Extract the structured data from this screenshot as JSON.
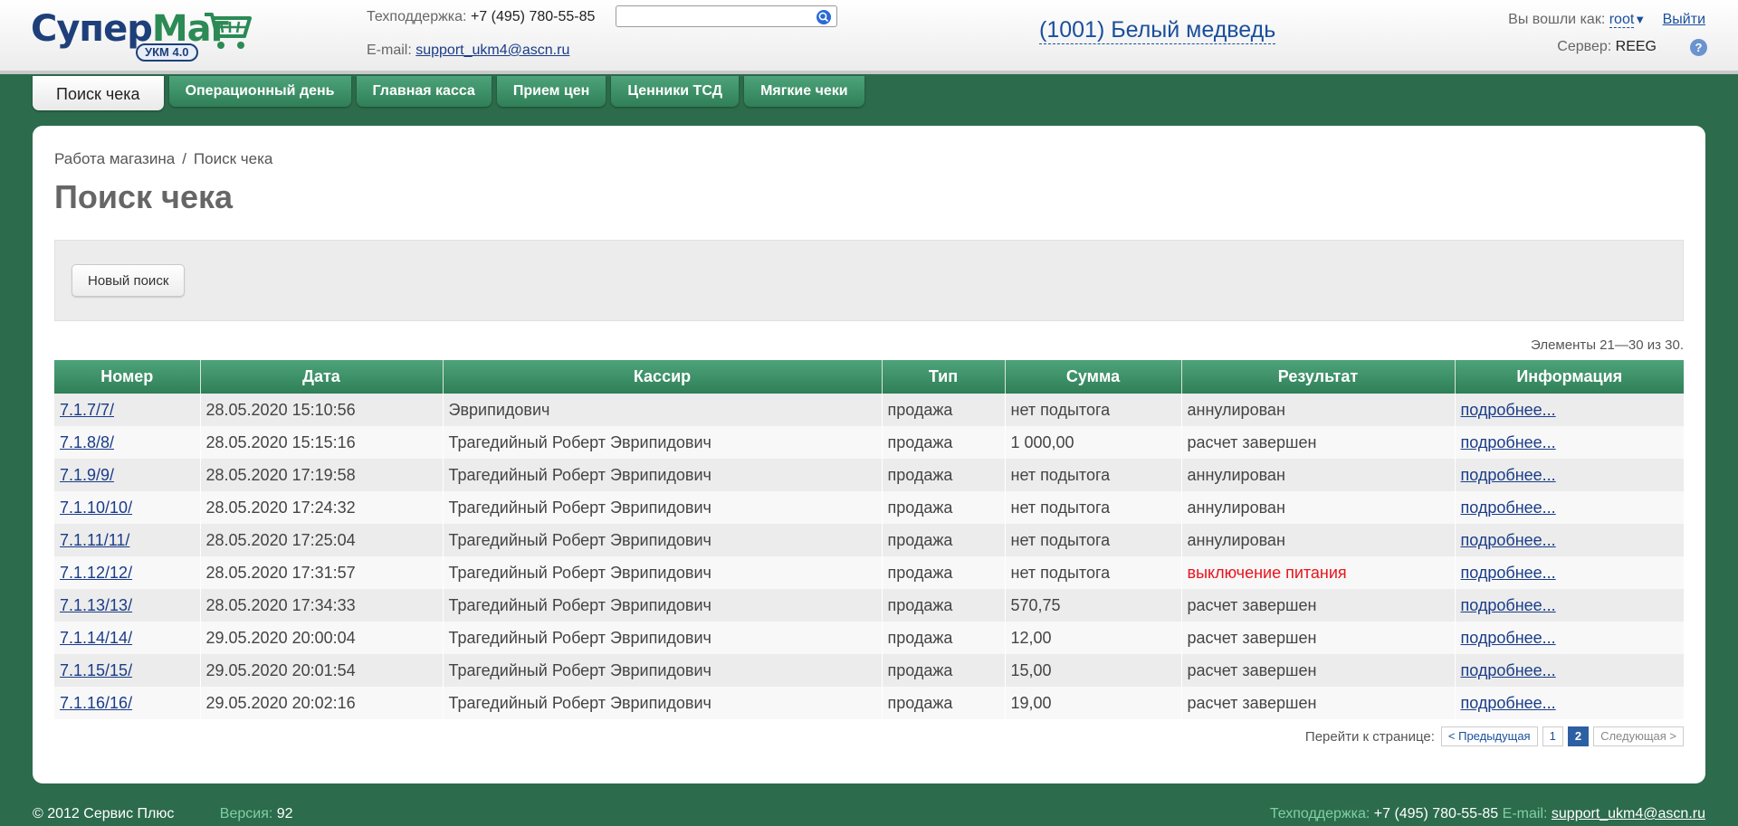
{
  "header": {
    "logo_part1": "Супер",
    "logo_part2": "Маг",
    "logo_badge": "УКМ 4.0",
    "support_label": "Техподдержка:",
    "support_phone": "+7 (495) 780-55-85",
    "email_label": "E-mail:",
    "email": "support_ukm4@ascn.ru",
    "search_placeholder": "",
    "store_name": "(1001) Белый медведь",
    "logged_in_label": "Вы вошли как:",
    "user": "root",
    "logout_label": "Выйти",
    "server_label": "Сервер:",
    "server_value": "REEG",
    "help_glyph": "?"
  },
  "tabs": [
    {
      "label": "Поиск чека",
      "active": true
    },
    {
      "label": "Операционный день",
      "active": false
    },
    {
      "label": "Главная касса",
      "active": false
    },
    {
      "label": "Прием цен",
      "active": false
    },
    {
      "label": "Ценники ТСД",
      "active": false
    },
    {
      "label": "Мягкие чеки",
      "active": false
    }
  ],
  "breadcrumb": {
    "parent": "Работа магазина",
    "separator": "/",
    "current": "Поиск чека"
  },
  "page_title": "Поиск чека",
  "new_search_label": "Новый поиск",
  "elements_info": "Элементы 21—30 из 30.",
  "table": {
    "columns": [
      "Номер",
      "Дата",
      "Кассир",
      "Тип",
      "Сумма",
      "Результат",
      "Информация"
    ],
    "rows": [
      {
        "number": "7.1.7/7/",
        "date": "28.05.2020 15:10:56",
        "cashier": "Эврипидович",
        "type": "продажа",
        "sum": "нет подытога",
        "result": "аннулирован",
        "info": "подробнее..."
      },
      {
        "number": "7.1.8/8/",
        "date": "28.05.2020 15:15:16",
        "cashier": "Трагедийный Роберт Эврипидович",
        "type": "продажа",
        "sum": "1 000,00",
        "result": "расчет завершен",
        "info": "подробнее..."
      },
      {
        "number": "7.1.9/9/",
        "date": "28.05.2020 17:19:58",
        "cashier": "Трагедийный Роберт Эврипидович",
        "type": "продажа",
        "sum": "нет подытога",
        "result": "аннулирован",
        "info": "подробнее..."
      },
      {
        "number": "7.1.10/10/",
        "date": "28.05.2020 17:24:32",
        "cashier": "Трагедийный Роберт Эврипидович",
        "type": "продажа",
        "sum": "нет подытога",
        "result": "аннулирован",
        "info": "подробнее..."
      },
      {
        "number": "7.1.11/11/",
        "date": "28.05.2020 17:25:04",
        "cashier": "Трагедийный Роберт Эврипидович",
        "type": "продажа",
        "sum": "нет подытога",
        "result": "аннулирован",
        "info": "подробнее..."
      },
      {
        "number": "7.1.12/12/",
        "date": "28.05.2020 17:31:57",
        "cashier": "Трагедийный Роберт Эврипидович",
        "type": "продажа",
        "sum": "нет подытога",
        "result": "выключение питания",
        "info": "подробнее...",
        "error": true
      },
      {
        "number": "7.1.13/13/",
        "date": "28.05.2020 17:34:33",
        "cashier": "Трагедийный Роберт Эврипидович",
        "type": "продажа",
        "sum": "570,75",
        "result": "расчет завершен",
        "info": "подробнее..."
      },
      {
        "number": "7.1.14/14/",
        "date": "29.05.2020 20:00:04",
        "cashier": "Трагедийный Роберт Эврипидович",
        "type": "продажа",
        "sum": "12,00",
        "result": "расчет завершен",
        "info": "подробнее..."
      },
      {
        "number": "7.1.15/15/",
        "date": "29.05.2020 20:01:54",
        "cashier": "Трагедийный Роберт Эврипидович",
        "type": "продажа",
        "sum": "15,00",
        "result": "расчет завершен",
        "info": "подробнее..."
      },
      {
        "number": "7.1.16/16/",
        "date": "29.05.2020 20:02:16",
        "cashier": "Трагедийный Роберт Эврипидович",
        "type": "продажа",
        "sum": "19,00",
        "result": "расчет завершен",
        "info": "подробнее..."
      }
    ]
  },
  "pager": {
    "label": "Перейти к странице:",
    "prev": "< Предыдущая",
    "pages": [
      "1",
      "2"
    ],
    "current": "2",
    "next": "Следующая >"
  },
  "footer": {
    "copyright": "© 2012 Сервис Плюс",
    "version_label": "Версия:",
    "version": "92",
    "support_label": "Техподдержка:",
    "support_phone": "+7 (495) 780-55-85",
    "email_label": "E-mail:",
    "email": "support_ukm4@ascn.ru"
  },
  "colors": {
    "brand_green": "#2c6b4c",
    "header_green": "#3f9468",
    "link_blue": "#1a3c88",
    "error_red": "#e8131c"
  }
}
